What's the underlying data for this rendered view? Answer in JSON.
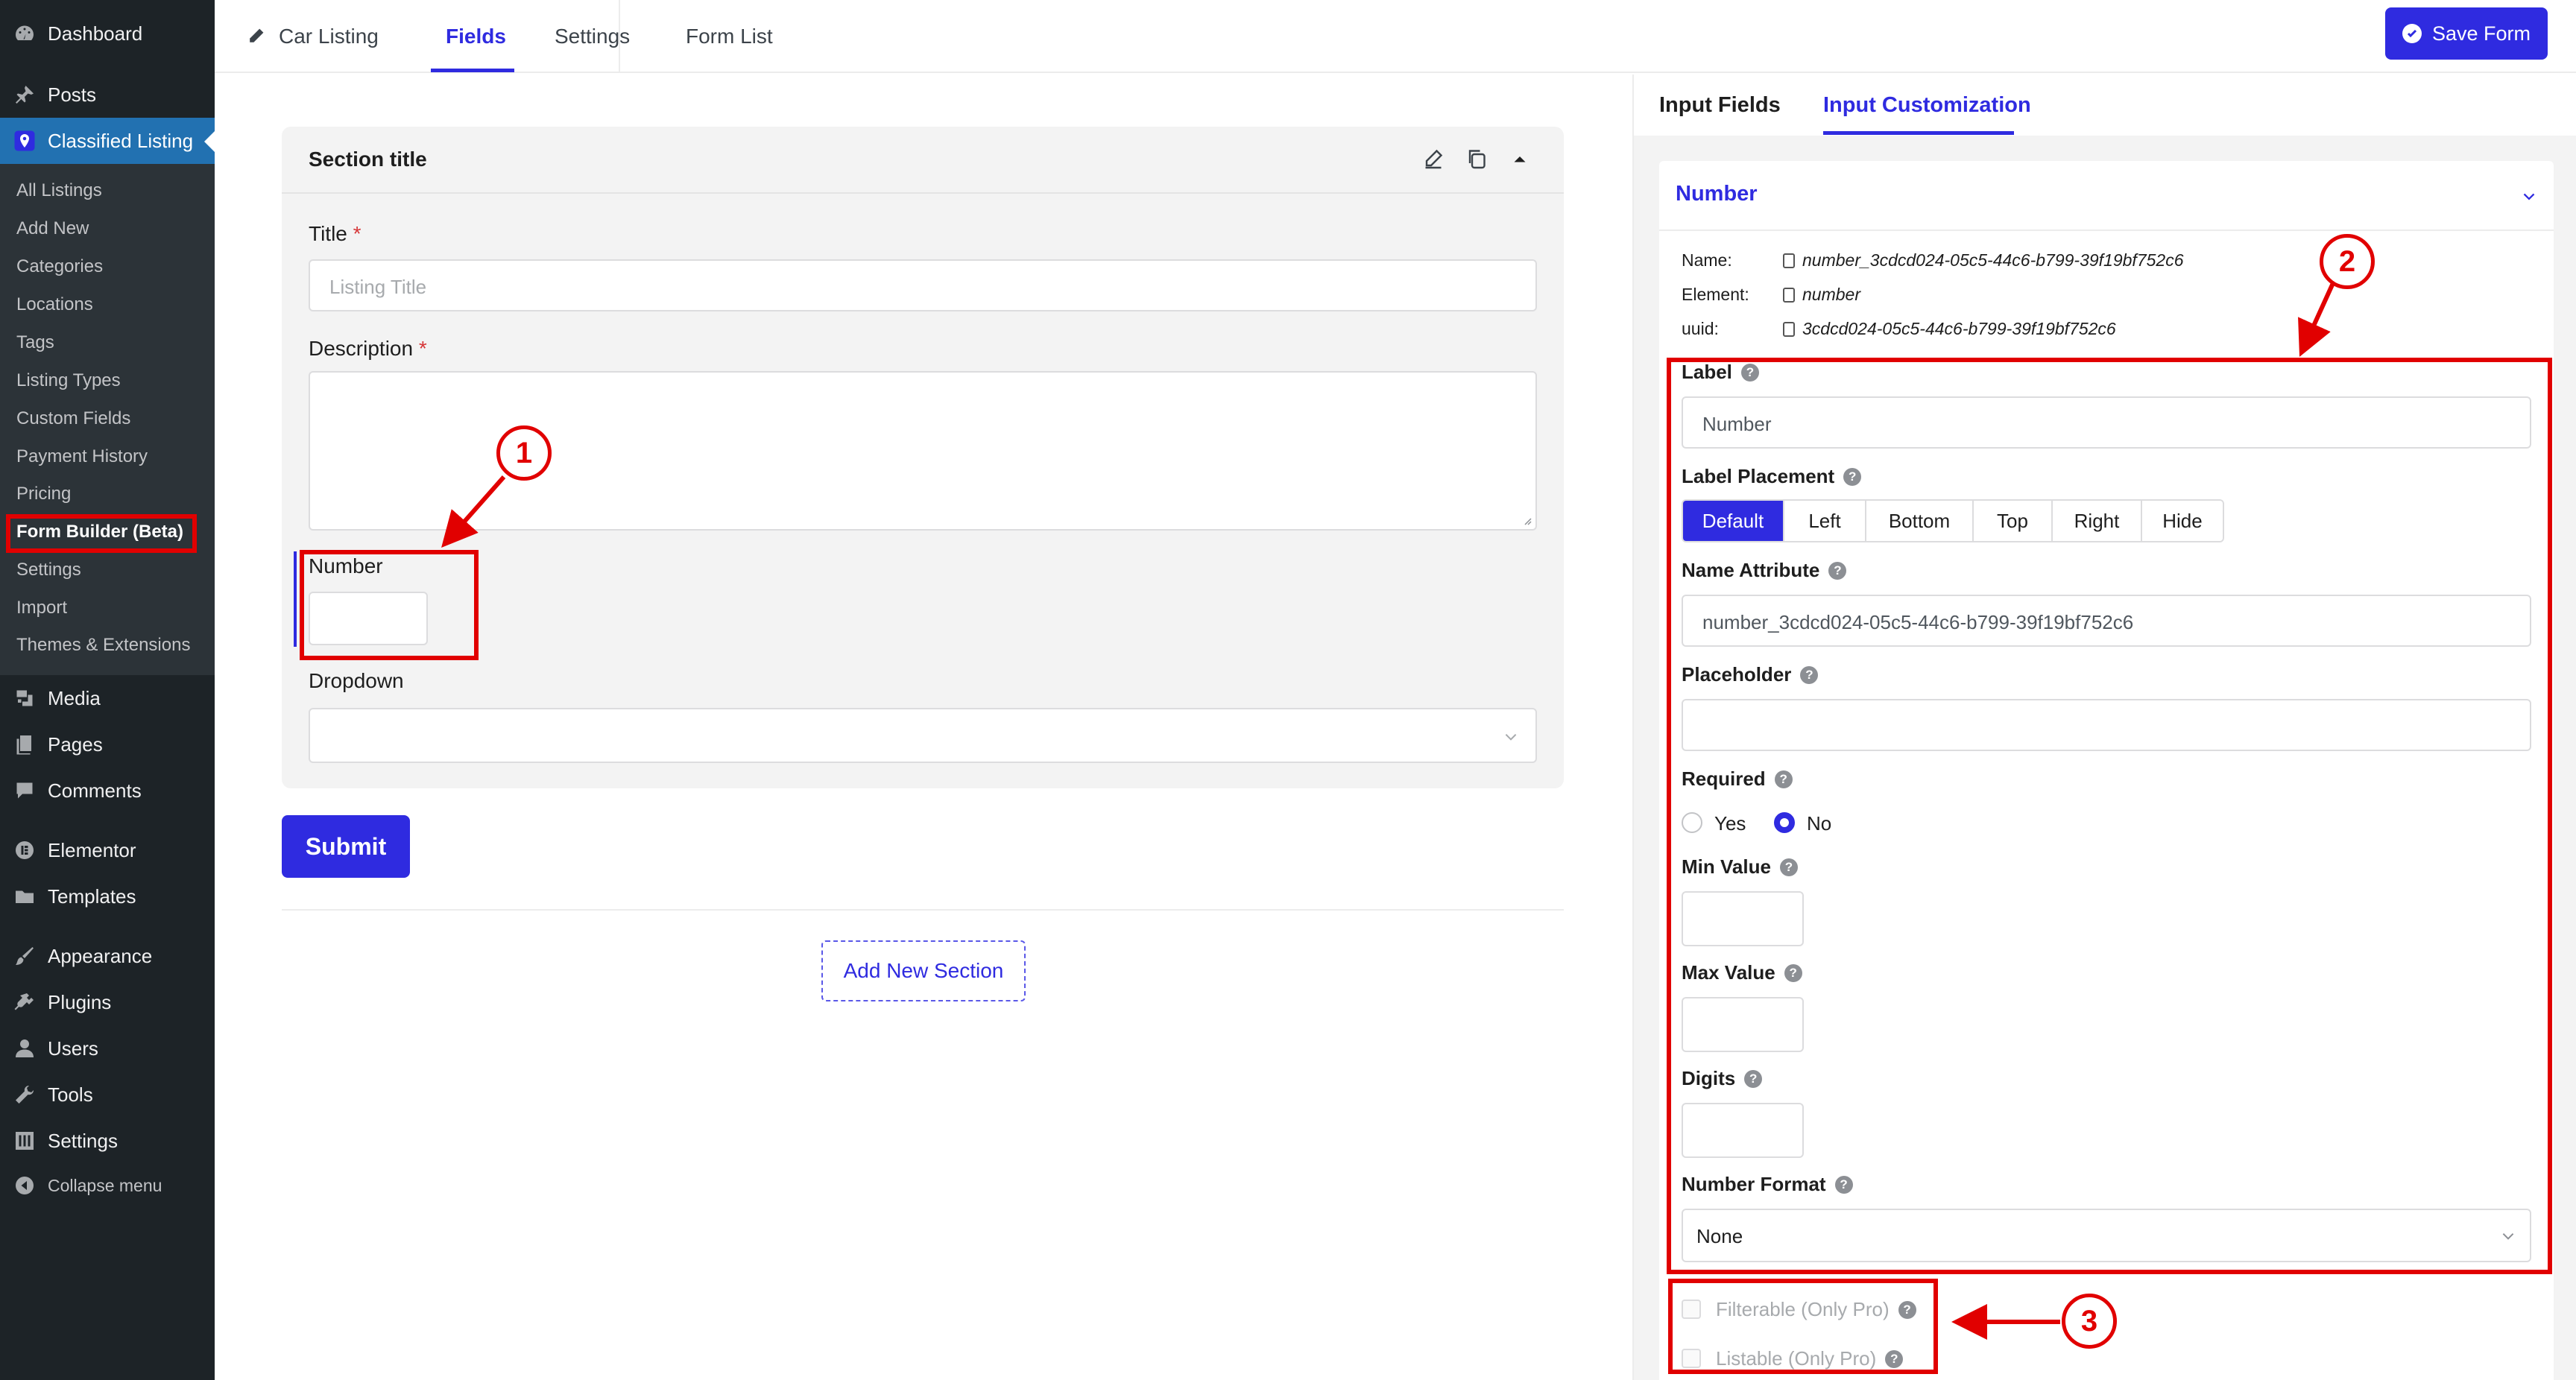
{
  "wp_menu": {
    "dashboard": "Dashboard",
    "posts": "Posts",
    "classified_listing": "Classified Listing",
    "submenu": [
      "All Listings",
      "Add New",
      "Categories",
      "Locations",
      "Tags",
      "Listing Types",
      "Custom Fields",
      "Payment History",
      "Pricing",
      "Form Builder (Beta)",
      "Settings",
      "Import",
      "Themes & Extensions"
    ],
    "media": "Media",
    "pages": "Pages",
    "comments": "Comments",
    "elementor": "Elementor",
    "templates": "Templates",
    "appearance": "Appearance",
    "plugins": "Plugins",
    "users": "Users",
    "tools": "Tools",
    "settings": "Settings",
    "collapse": "Collapse menu"
  },
  "topbar": {
    "form_name": "Car Listing",
    "tabs": [
      "Fields",
      "Settings",
      "Form List"
    ],
    "active_tab": "Fields",
    "save_label": "Save Form"
  },
  "form": {
    "section_title": "Section title",
    "title_label": "Title",
    "title_placeholder": "Listing Title",
    "required_mark": "*",
    "description_label": "Description",
    "number_label": "Number",
    "dropdown_label": "Dropdown",
    "submit_label": "Submit",
    "add_section_label": "Add New Section"
  },
  "panel": {
    "tabs": [
      "Input Fields",
      "Input Customization"
    ],
    "active_tab": "Input Customization",
    "field_type": "Number",
    "meta": {
      "name_key": "Name:",
      "name_value": "number_3cdcd024-05c5-44c6-b799-39f19bf752c6",
      "element_key": "Element:",
      "element_value": "number",
      "uuid_key": "uuid:",
      "uuid_value": "3cdcd024-05c5-44c6-b799-39f19bf752c6"
    },
    "label_title": "Label",
    "label_value": "Number",
    "placement_title": "Label Placement",
    "placement_options": [
      "Default",
      "Left",
      "Bottom",
      "Top",
      "Right",
      "Hide"
    ],
    "placement_selected": "Default",
    "name_attr_title": "Name Attribute",
    "name_attr_value": "number_3cdcd024-05c5-44c6-b799-39f19bf752c6",
    "placeholder_title": "Placeholder",
    "placeholder_value": "",
    "required_title": "Required",
    "required_yes": "Yes",
    "required_no": "No",
    "required_selected": "No",
    "min_title": "Min Value",
    "max_title": "Max Value",
    "digits_title": "Digits",
    "format_title": "Number Format",
    "format_value": "None",
    "filterable_label": "Filterable (Only Pro)",
    "listable_label": "Listable (Only Pro)",
    "help_glyph": "?"
  },
  "callouts": [
    "1",
    "2",
    "3"
  ],
  "colors": {
    "accent": "#2f2be0",
    "wp_sidebar": "#1d2327",
    "wp_active": "#2271b1",
    "highlight_red": "#e10000"
  }
}
